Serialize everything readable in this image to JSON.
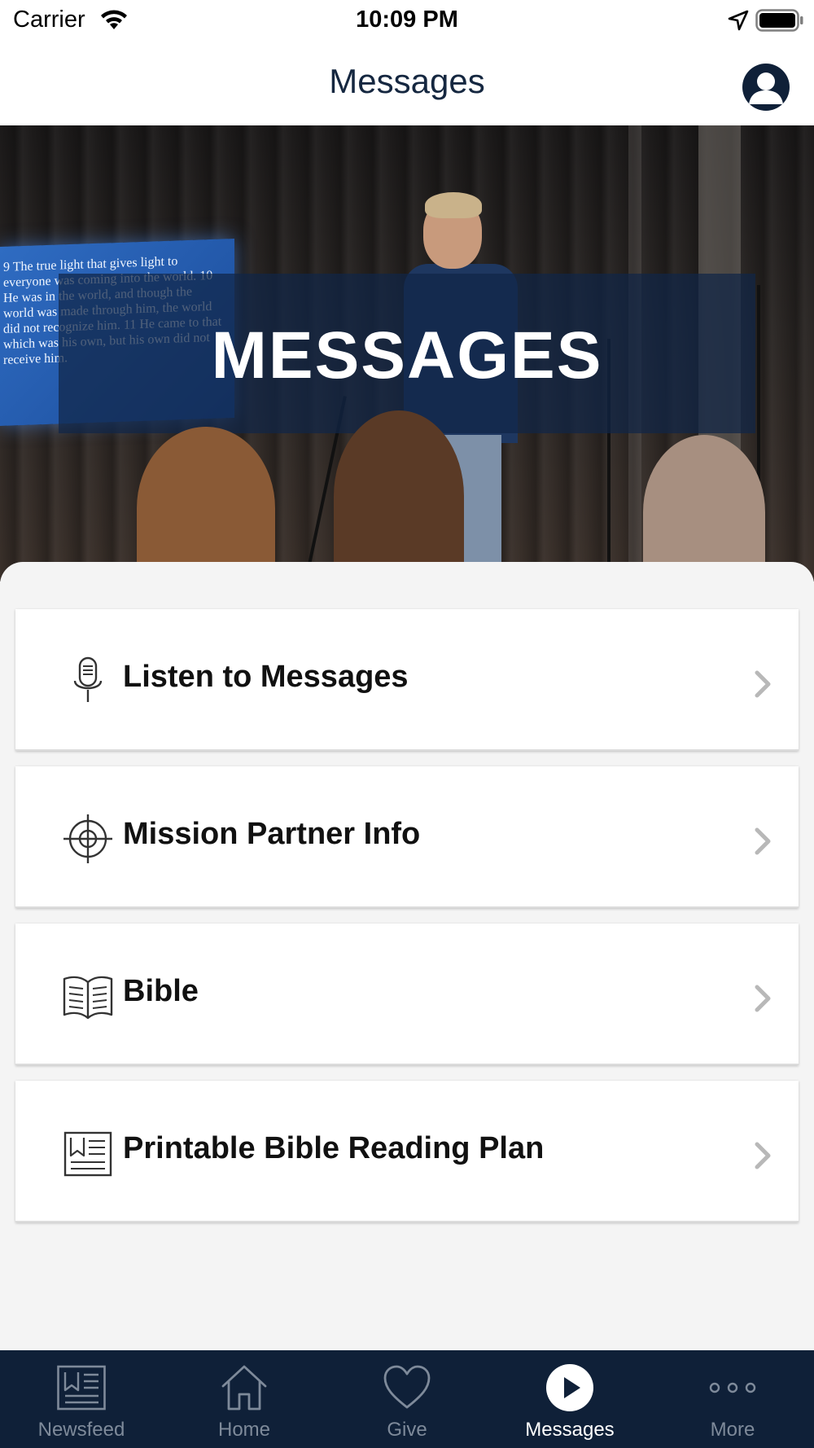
{
  "status_bar": {
    "carrier": "Carrier",
    "time": "10:09 PM"
  },
  "header": {
    "title": "Messages"
  },
  "hero": {
    "title": "MESSAGES",
    "screen_text": "9 The true light that gives light to everyone was coming into the world. 10 He was in the world, and though the world was made through him, the world did not recognize him. 11 He came to that which was his own, but his own did not receive him."
  },
  "menu": {
    "items": [
      {
        "label": "Listen to Messages",
        "icon": "microphone-icon"
      },
      {
        "label": "Mission Partner Info",
        "icon": "crosshair-icon"
      },
      {
        "label": "Bible",
        "icon": "open-book-icon"
      },
      {
        "label": "Printable Bible Reading Plan",
        "icon": "newspaper-icon"
      }
    ]
  },
  "tab_bar": {
    "tabs": [
      {
        "label": "Newsfeed",
        "icon": "newspaper-icon",
        "active": false
      },
      {
        "label": "Home",
        "icon": "home-icon",
        "active": false
      },
      {
        "label": "Give",
        "icon": "heart-icon",
        "active": false
      },
      {
        "label": "Messages",
        "icon": "play-icon",
        "active": true
      },
      {
        "label": "More",
        "icon": "more-dots-icon",
        "active": false
      }
    ]
  },
  "colors": {
    "navy": "#0f2038",
    "title_text": "#152740",
    "inactive_tab": "#7e8a9a",
    "background": "#f4f4f4"
  }
}
